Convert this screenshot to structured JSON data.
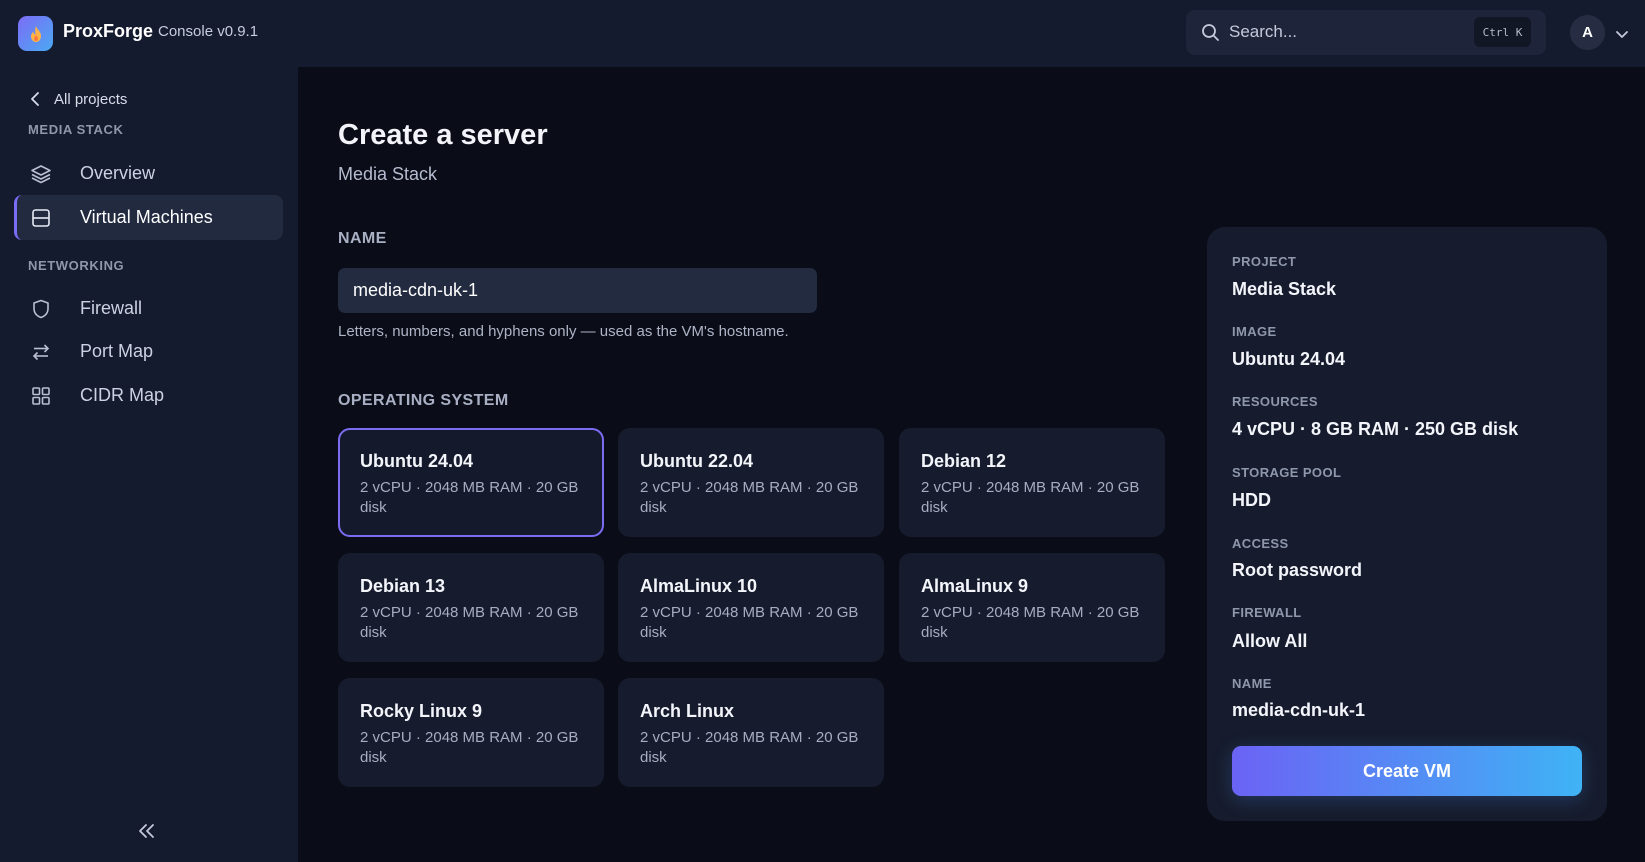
{
  "brand": {
    "name": "ProxForge",
    "version": "Console v0.9.1"
  },
  "search": {
    "placeholder": "Search...",
    "shortcut": "Ctrl K"
  },
  "user": {
    "avatar_initial": "A"
  },
  "sidebar": {
    "back_label": "All projects",
    "sections": [
      {
        "title": "MEDIA STACK",
        "items": [
          {
            "label": "Overview",
            "icon": "layers-icon",
            "active": false
          },
          {
            "label": "Virtual Machines",
            "icon": "server-icon",
            "active": true
          }
        ]
      },
      {
        "title": "NETWORKING",
        "items": [
          {
            "label": "Firewall",
            "icon": "shield-icon",
            "active": false
          },
          {
            "label": "Port Map",
            "icon": "arrows-swap-icon",
            "active": false
          },
          {
            "label": "CIDR Map",
            "icon": "grid-icon",
            "active": false
          }
        ]
      }
    ]
  },
  "page": {
    "title": "Create a server",
    "subtitle": "Media Stack",
    "name_label": "NAME",
    "name_value": "media-cdn-uk-1",
    "name_hint": "Letters, numbers, and hyphens only — used as the VM's hostname.",
    "os_label": "OPERATING SYSTEM",
    "os_options": [
      {
        "name": "Ubuntu 24.04",
        "spec": "2 vCPU · 2048 MB RAM · 20 GB disk",
        "selected": true
      },
      {
        "name": "Ubuntu 22.04",
        "spec": "2 vCPU · 2048 MB RAM · 20 GB disk",
        "selected": false
      },
      {
        "name": "Debian 12",
        "spec": "2 vCPU · 2048 MB RAM · 20 GB disk",
        "selected": false
      },
      {
        "name": "Debian 13",
        "spec": "2 vCPU · 2048 MB RAM · 20 GB disk",
        "selected": false
      },
      {
        "name": "AlmaLinux 10",
        "spec": "2 vCPU · 2048 MB RAM · 20 GB disk",
        "selected": false
      },
      {
        "name": "AlmaLinux 9",
        "spec": "2 vCPU · 2048 MB RAM · 20 GB disk",
        "selected": false
      },
      {
        "name": "Rocky Linux 9",
        "spec": "2 vCPU · 2048 MB RAM · 20 GB disk",
        "selected": false
      },
      {
        "name": "Arch Linux",
        "spec": "2 vCPU · 2048 MB RAM · 20 GB disk",
        "selected": false
      }
    ]
  },
  "summary": {
    "rows": [
      {
        "label": "PROJECT",
        "value": "Media Stack"
      },
      {
        "label": "IMAGE",
        "value": "Ubuntu 24.04"
      },
      {
        "label": "RESOURCES",
        "value": "4 vCPU · 8 GB RAM · 250 GB disk"
      },
      {
        "label": "STORAGE POOL",
        "value": "HDD"
      },
      {
        "label": "ACCESS",
        "value": "Root password"
      },
      {
        "label": "FIREWALL",
        "value": "Allow All"
      },
      {
        "label": "NAME",
        "value": "media-cdn-uk-1"
      }
    ],
    "create_label": "Create VM"
  },
  "colors": {
    "accent": "#7c6cf2",
    "button_gradient_start": "#6b63f5",
    "button_gradient_end": "#3fb3f5"
  }
}
